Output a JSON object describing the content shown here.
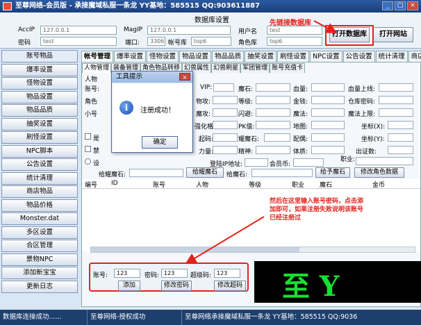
{
  "titlebar": {
    "title": "至尊网络-会员版 - 承接魔域私服一条龙 YY基地：585515  QQ:903611887",
    "min": "_",
    "max": "□",
    "close": "×"
  },
  "settings": {
    "title": "数据库设置",
    "accip_label": "AccIP",
    "accip_value": "127.0.0.1",
    "pwd_label": "密码",
    "pwd_value": "test",
    "magip_label": "MagIP",
    "magip_value": "127.0.0.1",
    "port_label": "端口:",
    "port_value": "3306",
    "acctdb_label": "帐号库",
    "acctdb_value": "top6",
    "user_label": "用户名",
    "user_value": "test",
    "roledb_label": "角色库",
    "roledb_value": "top6",
    "open_db_btn": "打开数据库",
    "open_site_btn": "打开网站",
    "annotation": "先链接数据库"
  },
  "sidebar": {
    "items": [
      "账号物品",
      "爆率设置",
      "怪物设置",
      "物品设置",
      "物品品质",
      "抽奖设置",
      "刷怪设置",
      "NPC脚本",
      "公告设置",
      "统计清理",
      "商店物品",
      "物品价格",
      "Monster.dat",
      "多区设置",
      "合区管理",
      "景物NPC",
      "添加新宝宝",
      "更新日志"
    ]
  },
  "top_tabs": [
    "帐号管理",
    "爆率设置",
    "怪物设置",
    "物品设置",
    "物品品质",
    "抽奖设置",
    "刷怪设置",
    "NPC设置",
    "公告设置",
    "统计清理",
    "商店物品"
  ],
  "sub_tabs": [
    "人物管理",
    "装备管理",
    "角色物品转移",
    "幻兽属性",
    "幻兽刷星",
    "军团管理",
    "账号充值卡"
  ],
  "form": {
    "person_label": "人物",
    "row1": [
      "账号:",
      "VIP:",
      "魔石:",
      "血量:",
      "血量上线:"
    ],
    "row2": [
      "角色",
      "物攻:",
      "等级:",
      "金钱:",
      "仓库密码:"
    ],
    "row3": [
      "小号",
      "魔攻:",
      "闪避:",
      "魔法:",
      "魔法上限:"
    ],
    "row4": [
      "强化格",
      "PK值:",
      "地图:",
      "坐标(X):"
    ],
    "row5": [
      "是",
      "起码:",
      "耀魔石:",
      "配偶:",
      "坐标(Y):"
    ],
    "row6": [
      "禁",
      "力量:",
      "精神:",
      "体质:",
      "出证数:"
    ],
    "row7_radio": "设",
    "row7": [
      "登陆IP地址:",
      "会员币:",
      "职业:"
    ],
    "give_label": "给耀魔石:",
    "give_btn": "给耀魔石",
    "give_magic_label": "给魔石:",
    "give_magic_btn": "给予魔石",
    "edit_role_btn": "修改角色数据"
  },
  "grid": {
    "headers": [
      "编号",
      "ID",
      "账号",
      "人物",
      "等级",
      "职业",
      "魔石",
      "金币"
    ]
  },
  "annotation2": "然后在这里输入账号密码，点击添加即可，如果注册失败说明该账号已经注册过",
  "bottom": {
    "account_label": "账号:",
    "account_value": "123",
    "password_label": "密码:",
    "password_value": "123",
    "super_label": "超级码:",
    "super_value": "123",
    "add_btn": "添加",
    "change_pwd_btn": "修改密码",
    "change_super_btn": "修改超码"
  },
  "banner": {
    "text": "至 Y"
  },
  "dialog": {
    "title": "工具提示",
    "message": "注册成功！",
    "ok": "确定",
    "close": "×",
    "icon": "i"
  },
  "status": [
    "数据库连接成功......",
    "至尊网络-授权成功",
    "至尊网络承接魔域私服一条龙 YY基地：585515  QQ:9036"
  ],
  "colors": {
    "accent": "#e2231a",
    "banner_text": "#18e030"
  }
}
